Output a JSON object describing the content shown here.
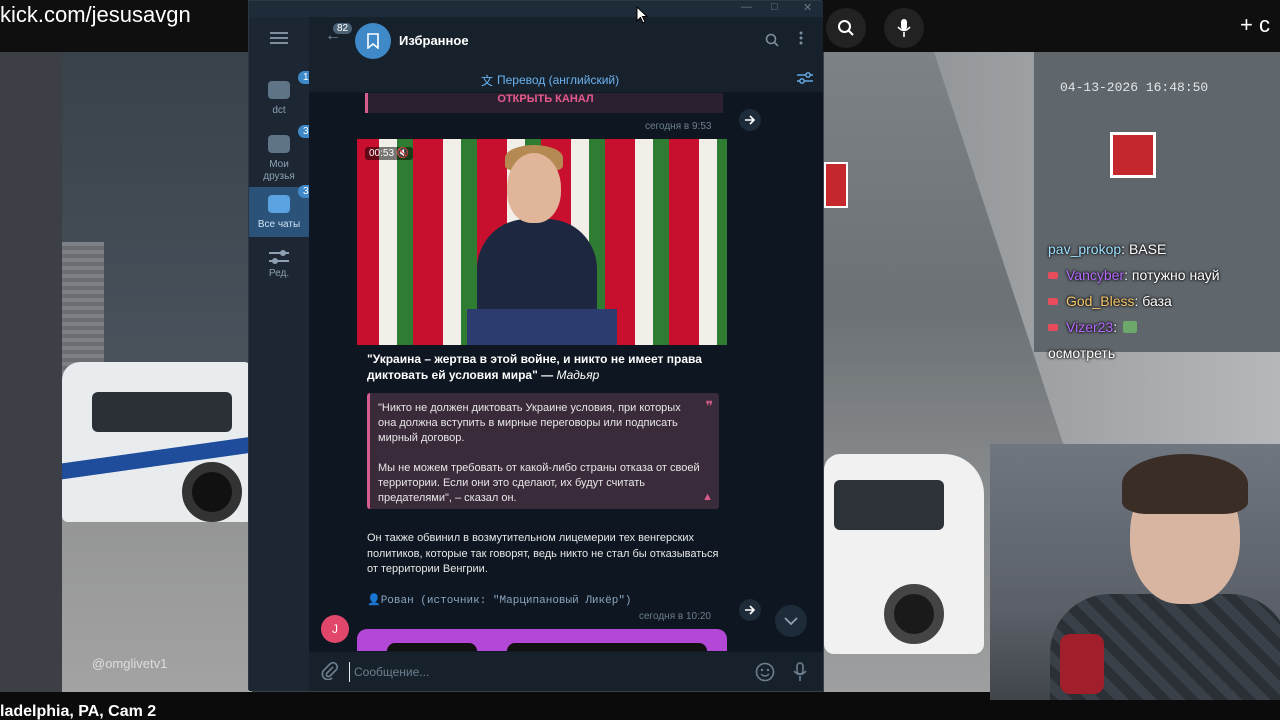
{
  "browser": {
    "url": "kick.com/jesusavgn",
    "create_label": "+ c"
  },
  "stream": {
    "timestamp": "04-13-2026 16:48:50",
    "watermark": "@omglivetv1",
    "bottom_title": "ladelphia, PA, Cam 2"
  },
  "chat": {
    "messages": [
      {
        "user": "pav_prokop",
        "text": " : BASE",
        "badge": false,
        "user_color": "#ffffff"
      },
      {
        "user": "Vancyber",
        "text": " : потужно науй",
        "badge": true,
        "user_color": "#b86bff"
      },
      {
        "user": "God_Bless",
        "text": " : база",
        "badge": true,
        "user_color": "#f7c66b"
      },
      {
        "user": "Vizer23",
        "text": " : ",
        "badge": true,
        "user_color": "#b86bff",
        "emote": true
      },
      {
        "user": "",
        "text": "осмотреть",
        "badge": false,
        "user_color": "#ffffff"
      }
    ]
  },
  "telegram": {
    "rail": [
      {
        "label": "dct",
        "count": "188"
      },
      {
        "label": "Мои друзья",
        "count": "38"
      },
      {
        "label": "Все чаты",
        "count": "347",
        "active": true
      },
      {
        "label": "Ред.",
        "count": ""
      }
    ],
    "back_count": "82",
    "chat_title": "Избранное",
    "translate_label": "Перевод (английский)",
    "open_channel": "ОТКРЫТЬ КАНАЛ",
    "time1": "сегодня в 9:53",
    "video_time": "00:53",
    "caption_bold": "\"Украина – жертва в этой войне, и никто не имеет права диктовать ей условия мира\" — ",
    "caption_italic": "Мадьяр",
    "quote_p1": "\"Никто не должен диктовать Украине условия, при которых она должна вступить в мирные переговоры или подписать мирный договор.",
    "quote_p2": "Мы не можем требовать от какой-либо страны отказа от своей территории. Если они это сделают, их будут считать предателями\", – сказал он.",
    "body": "Он также обвинил в возмутительном лицемерии тех венгерских политиков, которые так говорят, ведь никто не стал бы отказываться от территории Венгрии.",
    "author": "👤Рован (источник: \"Марципановый Ликёр\")",
    "time2": "сегодня в 10:20",
    "avatar_letter": "J",
    "input_placeholder": "Сообщение..."
  }
}
